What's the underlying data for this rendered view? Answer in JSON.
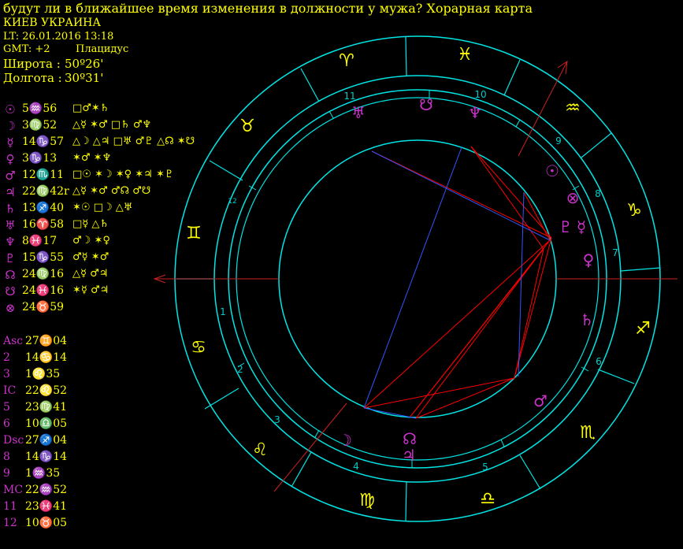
{
  "header": {
    "title": "будут ли в ближайшее время изменения в должности у мужа? Хорарная карта",
    "city": "КИЕВ УКРАИНА",
    "local_time": "LT: 26.01.2016  13:18",
    "gmt": "GMT: +2",
    "house_system": "Плацидус",
    "latitude_label": "Широта :",
    "latitude_value": "50º26'",
    "longitude_label": "Долгота :",
    "longitude_value": "30º31'"
  },
  "planets": [
    {
      "glyph": "☉",
      "pos": "5♒56",
      "aspects": "□♂✶♄"
    },
    {
      "glyph": "☽",
      "pos": "3♍52",
      "aspects": "△☿ ✶♂ □♄ ♂♆"
    },
    {
      "glyph": "☿",
      "pos": "14♑57",
      "aspects": "△☽ △♃ □♅ ♂♇ △☊ ✶☋"
    },
    {
      "glyph": "♀",
      "pos": "3♑13",
      "aspects": "✶♂ ✶♆"
    },
    {
      "glyph": "♂",
      "pos": "12♏11",
      "aspects": "□☉ ✶☽ ✶♀ ✶♃ ✶♇"
    },
    {
      "glyph": "♃",
      "pos": "22♍42r",
      "aspects": "△☿ ✶♂ ♂☊ ♂☋"
    },
    {
      "glyph": "♄",
      "pos": "13♐40",
      "aspects": "✶☉ □☽ △♅"
    },
    {
      "glyph": "♅",
      "pos": "16♈58",
      "aspects": "□☿ △♄"
    },
    {
      "glyph": "♆",
      "pos": "8♓17",
      "aspects": "♂☽ ✶♀"
    },
    {
      "glyph": "♇",
      "pos": "15♑55",
      "aspects": "♂☿ ✶♂"
    },
    {
      "glyph": "☊",
      "pos": "24♍16",
      "aspects": "△☿ ♂♃"
    },
    {
      "glyph": "☋",
      "pos": "24♓16",
      "aspects": "✶☿ ♂♃"
    },
    {
      "glyph": "⊗",
      "pos": "24♉59",
      "aspects": ""
    }
  ],
  "cusps": [
    {
      "name": "Asc",
      "pos": "27♊04"
    },
    {
      "name": "2",
      "pos": "14♋14"
    },
    {
      "name": "3",
      "pos": "1♌35"
    },
    {
      "name": "IC",
      "pos": "22♌52"
    },
    {
      "name": "5",
      "pos": "23♍41"
    },
    {
      "name": "6",
      "pos": "10♎05"
    },
    {
      "name": "Dsc",
      "pos": "27♐04"
    },
    {
      "name": "8",
      "pos": "14♑14"
    },
    {
      "name": "9",
      "pos": "1♒35"
    },
    {
      "name": "MC",
      "pos": "22♒52"
    },
    {
      "name": "11",
      "pos": "23♓41"
    },
    {
      "name": "12",
      "pos": "10♉05"
    }
  ],
  "colors": {
    "ring": "#00e5e5",
    "label_yellow": "#ffff00",
    "label_magenta": "#cc33cc",
    "aspect_red": "#ff0000",
    "aspect_blue": "#3355ff",
    "axis_red": "#cc2222",
    "house_number": "#00cccc"
  },
  "wheel": {
    "signs": [
      {
        "glyph": "♈",
        "name": "aries"
      },
      {
        "glyph": "♓",
        "name": "pisces"
      },
      {
        "glyph": "♒",
        "name": "aquarius"
      },
      {
        "glyph": "♑",
        "name": "capricorn"
      },
      {
        "glyph": "♐",
        "name": "sagittarius"
      },
      {
        "glyph": "♏",
        "name": "scorpio"
      },
      {
        "glyph": "♎",
        "name": "libra"
      },
      {
        "glyph": "♍",
        "name": "virgo"
      },
      {
        "glyph": "♌",
        "name": "leo"
      },
      {
        "glyph": "♋",
        "name": "cancer"
      },
      {
        "glyph": "♊",
        "name": "gemini"
      },
      {
        "glyph": "♉",
        "name": "taurus"
      }
    ],
    "house_numbers": [
      "1",
      "2",
      "3",
      "4",
      "5",
      "6",
      "7",
      "8",
      "9",
      "10",
      "11",
      "12"
    ],
    "planet_glyphs": [
      {
        "glyph": "♅",
        "name": "uranus"
      },
      {
        "glyph": "☋",
        "name": "south-node"
      },
      {
        "glyph": "♆",
        "name": "neptune"
      },
      {
        "glyph": "☉",
        "name": "sun"
      },
      {
        "glyph": "⊗",
        "name": "part-of-fortune"
      },
      {
        "glyph": "♇",
        "name": "pluto"
      },
      {
        "glyph": "☿",
        "name": "mercury"
      },
      {
        "glyph": "♀",
        "name": "venus"
      },
      {
        "glyph": "♄",
        "name": "saturn"
      },
      {
        "glyph": "♂",
        "name": "mars"
      },
      {
        "glyph": "☊",
        "name": "north-node"
      },
      {
        "glyph": "♃",
        "name": "jupiter"
      },
      {
        "glyph": "☽",
        "name": "moon"
      }
    ]
  }
}
